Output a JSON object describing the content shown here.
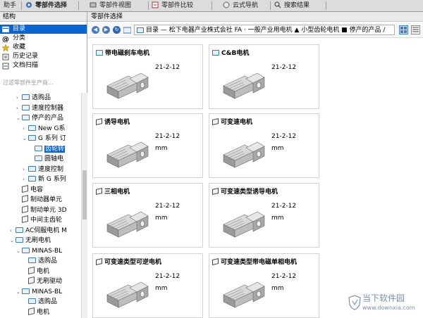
{
  "topbar": {
    "tabs": [
      {
        "label": "助手",
        "icon": ""
      },
      {
        "label": "零部件选择",
        "icon": "parts-icon",
        "active": true
      },
      {
        "label": "零部件视图",
        "icon": "parts-view-icon"
      },
      {
        "label": "零部件比较",
        "icon": "compare-icon"
      },
      {
        "label": "云式导航",
        "icon": "cloud-nav-icon"
      },
      {
        "label": "搜索结果",
        "icon": "search-results-icon"
      }
    ]
  },
  "left": {
    "header": "结构",
    "nav": [
      {
        "label": "目录",
        "icon": "catalog-icon",
        "selected": true
      },
      {
        "label": "分类",
        "icon": "at-icon"
      },
      {
        "label": "收藏",
        "icon": "star-icon"
      },
      {
        "label": "历史记录",
        "icon": "history-icon"
      },
      {
        "label": "文档扫描",
        "icon": "scan-icon"
      }
    ],
    "filter_placeholder": "过滤零部件生产商...",
    "tree": [
      {
        "label": "选购品",
        "indent": 3,
        "type": "folder",
        "tw": "›"
      },
      {
        "label": "速度控制器",
        "indent": 3,
        "type": "folder",
        "tw": "›"
      },
      {
        "label": "停产的产品",
        "indent": 3,
        "type": "folder",
        "tw": "⌄"
      },
      {
        "label": "New G系",
        "indent": 4,
        "type": "folder",
        "tw": "›"
      },
      {
        "label": "G 系列 订",
        "indent": 4,
        "type": "folder",
        "tw": "⌄"
      },
      {
        "label": "齿轮转",
        "indent": 5,
        "type": "folder",
        "tw": "",
        "highlight": true
      },
      {
        "label": "圆轴电",
        "indent": 5,
        "type": "folder",
        "tw": ""
      },
      {
        "label": "速度控制",
        "indent": 4,
        "type": "folder",
        "tw": "›"
      },
      {
        "label": "新 G 系列",
        "indent": 4,
        "type": "folder",
        "tw": "›"
      },
      {
        "label": "电容",
        "indent": 3,
        "type": "box",
        "tw": ""
      },
      {
        "label": "制动器单元",
        "indent": 3,
        "type": "box",
        "tw": ""
      },
      {
        "label": "制动单元 3D",
        "indent": 3,
        "type": "box",
        "tw": ""
      },
      {
        "label": "中间主齿轮",
        "indent": 3,
        "type": "box",
        "tw": ""
      },
      {
        "label": "AC伺服电机 M",
        "indent": 2,
        "type": "folder",
        "tw": "›"
      },
      {
        "label": "无刷电机",
        "indent": 2,
        "type": "folder",
        "tw": "⌄"
      },
      {
        "label": "MINAS-BL",
        "indent": 3,
        "type": "folder",
        "tw": "⌄"
      },
      {
        "label": "选购品",
        "indent": 4,
        "type": "folder",
        "tw": ""
      },
      {
        "label": "电机",
        "indent": 4,
        "type": "box",
        "tw": ""
      },
      {
        "label": "无刷驱动",
        "indent": 4,
        "type": "box",
        "tw": ""
      },
      {
        "label": "MINAS-BL",
        "indent": 3,
        "type": "folder",
        "tw": "⌄"
      },
      {
        "label": "选购品",
        "indent": 4,
        "type": "folder",
        "tw": ""
      },
      {
        "label": "电机",
        "indent": 4,
        "type": "box",
        "tw": ""
      }
    ]
  },
  "right": {
    "header": "零部件选择",
    "breadcrumb": "目录  —  松下电器产业株式会社   FA  ·  一般产业用电机  ▲  小型齿轮电机  ■  停产的产品 /",
    "cards": [
      {
        "title": "带电磁刹车电机",
        "icon": "folder",
        "date": "21-2-12",
        "unit": ""
      },
      {
        "title": "C&B电机",
        "icon": "folder",
        "date": "21-2-12",
        "unit": ""
      },
      {
        "title": "诱导电机",
        "icon": "box",
        "date": "21-2-12",
        "unit": "mm"
      },
      {
        "title": "可变速电机",
        "icon": "box",
        "date": "21-2-12",
        "unit": "mm"
      },
      {
        "title": "三相电机",
        "icon": "box",
        "date": "21-2-12",
        "unit": "mm"
      },
      {
        "title": "可变速类型诱导电机",
        "icon": "box",
        "date": "21-2-12",
        "unit": "mm"
      },
      {
        "title": "可变速类型可逆电机",
        "icon": "box",
        "date": "21-2-12",
        "unit": "mm"
      },
      {
        "title": "可变速类型带电磁单相电机",
        "icon": "box",
        "date": "21-2-12",
        "unit": "mm"
      }
    ]
  },
  "watermark": {
    "line1": "当下软件园",
    "line2": "www.downxia.com"
  }
}
